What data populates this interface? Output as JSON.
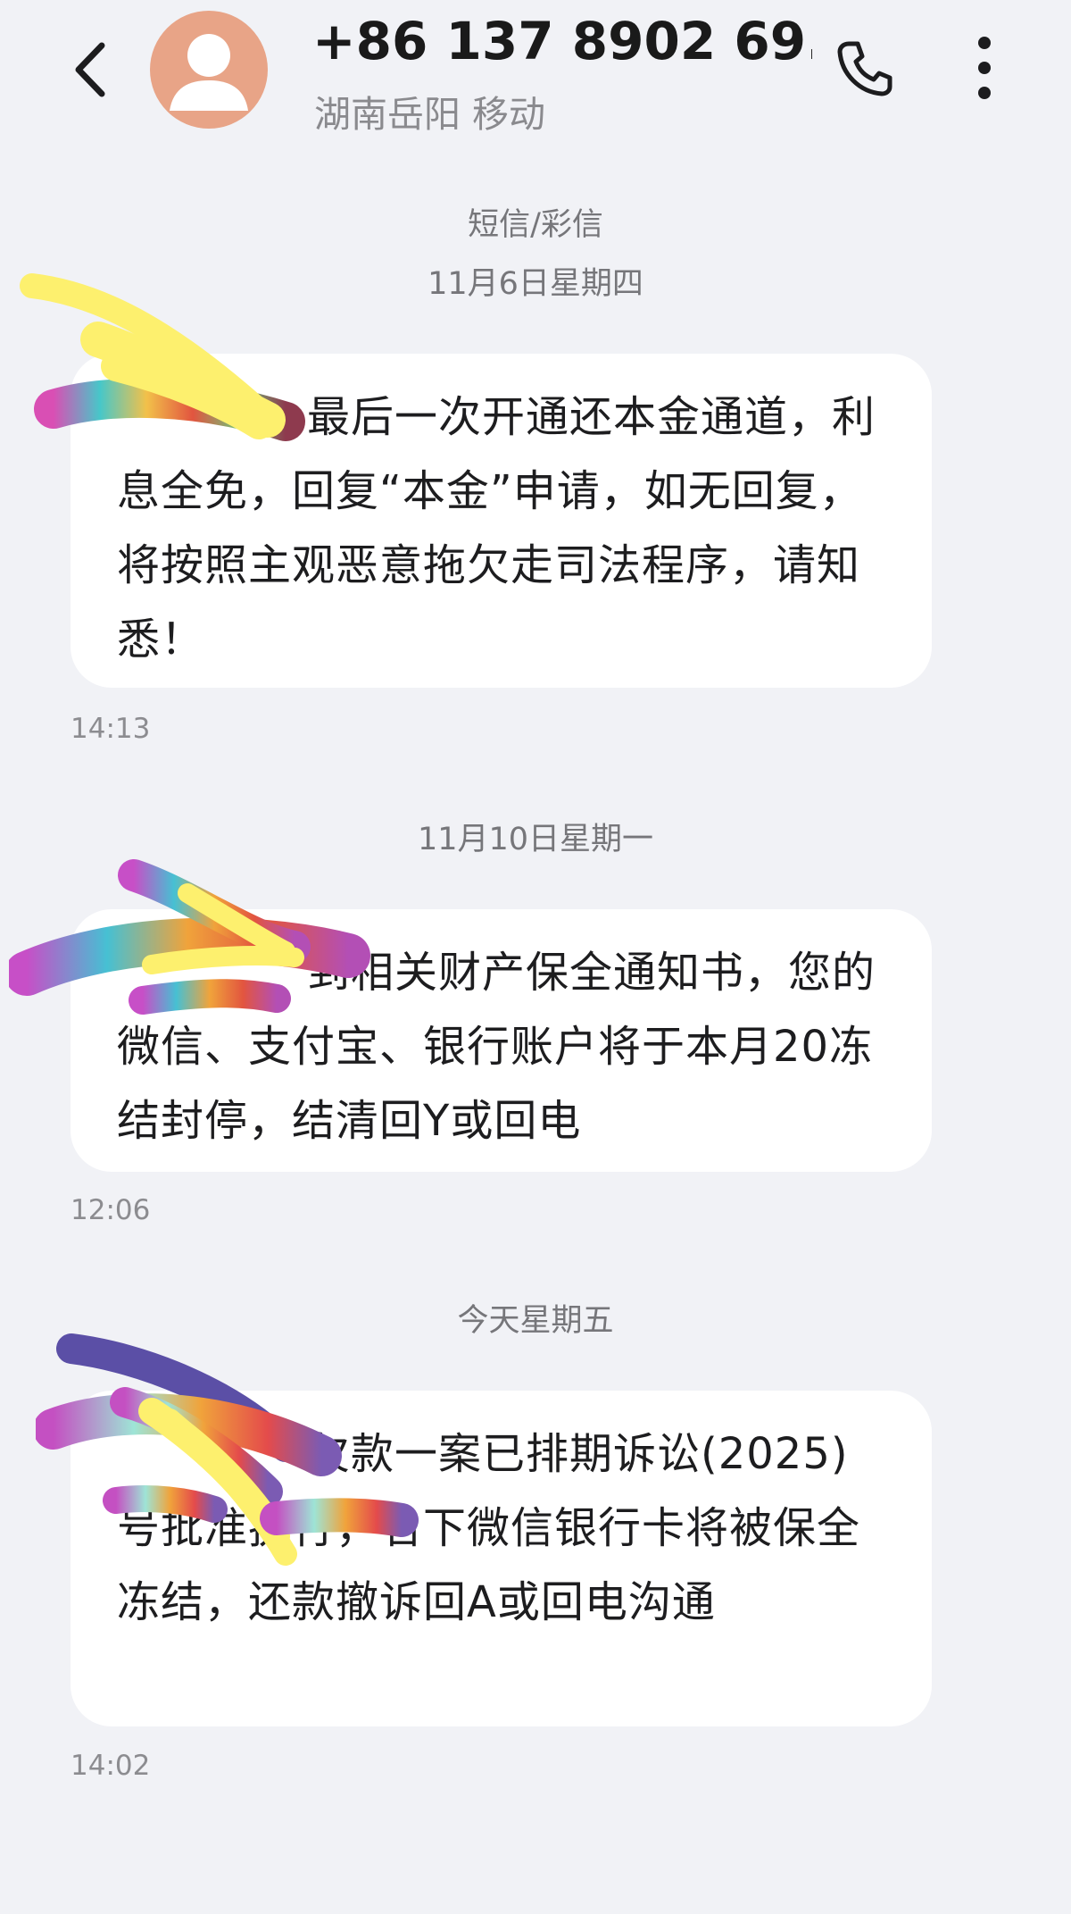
{
  "header": {
    "back_icon": "chevron-left-icon",
    "avatar_icon": "person-icon",
    "contact_name": "+86 137 8902 69...",
    "contact_sub": "湖南岳阳 移动",
    "call_icon": "phone-icon",
    "more_icon": "more-vertical-icon"
  },
  "thread": {
    "type_label": "短信/彩信",
    "groups": [
      {
        "date": "11月6日星期四",
        "text": "最后一次开通还本金通道，利息全免，回复“本金”申请，如无回复，将按照主观恶意拖欠走司法程序，请知悉！",
        "time": "14:13"
      },
      {
        "date": "11月10日星期一",
        "text": "到相关财产保全通知书，您的微信、支付宝、银行账户将于本月20冻结封停，结清回Y或回电",
        "time": "12:06"
      },
      {
        "date": "今天星期五",
        "text": "欠款一案已排期诉讼(2025)号批准执行，名下微信银行卡将被保全冻结，还款撤诉回A或回电沟通",
        "time": "14:02"
      }
    ]
  },
  "colors": {
    "background": "#f1f2f6",
    "bubble": "#ffffff",
    "avatar": "#e8a487",
    "redact_yellow": "#fdf06e",
    "redact_purple": "#5b4fa6"
  }
}
